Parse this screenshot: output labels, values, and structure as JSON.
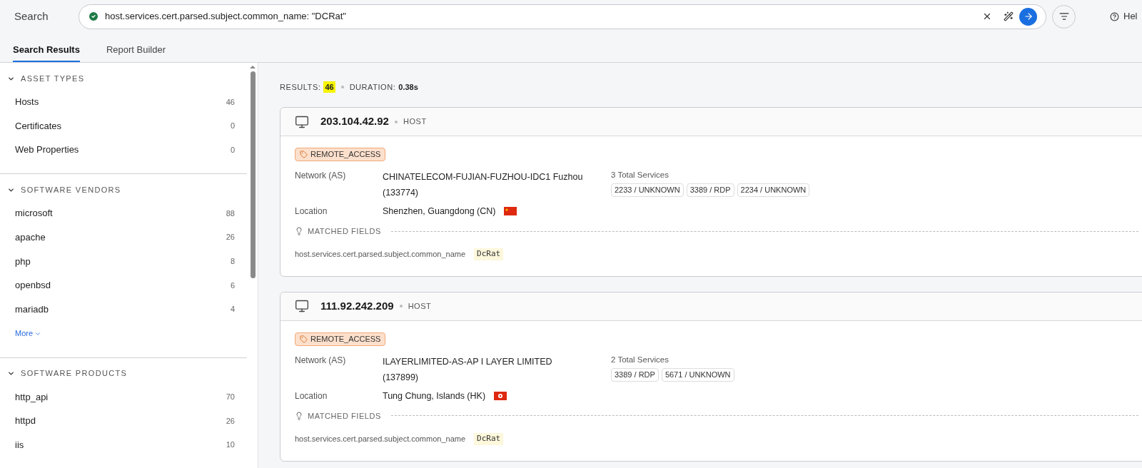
{
  "header": {
    "title": "Search",
    "query": "host.services.cert.parsed.subject.common_name: \"DCRat\"",
    "help": "Hel"
  },
  "tabs": [
    {
      "label": "Search Results",
      "selected": true
    },
    {
      "label": "Report Builder",
      "selected": false
    }
  ],
  "sidebar": {
    "sections": [
      {
        "title": "ASSET TYPES",
        "expanded": true,
        "items": [
          {
            "label": "Hosts",
            "count": "46"
          },
          {
            "label": "Certificates",
            "count": "0"
          },
          {
            "label": "Web Properties",
            "count": "0"
          }
        ]
      },
      {
        "title": "SOFTWARE VENDORS",
        "expanded": true,
        "items": [
          {
            "label": "microsoft",
            "count": "88"
          },
          {
            "label": "apache",
            "count": "26"
          },
          {
            "label": "php",
            "count": "8"
          },
          {
            "label": "openbsd",
            "count": "6"
          },
          {
            "label": "mariadb",
            "count": "4"
          }
        ],
        "more": "More"
      },
      {
        "title": "SOFTWARE PRODUCTS",
        "expanded": true,
        "items": [
          {
            "label": "http_api",
            "count": "70"
          },
          {
            "label": "httpd",
            "count": "26"
          },
          {
            "label": "iis",
            "count": "10"
          }
        ]
      }
    ]
  },
  "summary": {
    "results_label": "RESULTS:",
    "results": "46",
    "results_highlighted": true,
    "duration_label": "DURATION:",
    "duration": "0.38s"
  },
  "results": [
    {
      "ip": "203.104.42.92",
      "type": "HOST",
      "tag": "REMOTE_ACCESS",
      "network_label": "Network (AS)",
      "network": "CHINATELECOM-FUJIAN-FUZHOU-IDC1 Fuzhou",
      "asn": "(133774)",
      "location_label": "Location",
      "location": "Shenzhen, Guangdong (CN)",
      "flag": {
        "kind": "cn"
      },
      "services_total": "3 Total Services",
      "services": [
        "2233 / UNKNOWN",
        "3389 / RDP",
        "2234 / UNKNOWN"
      ],
      "matched_label": "MATCHED FIELDS",
      "field": "host.services.cert.parsed.subject.common_name",
      "value": "DcRat"
    },
    {
      "ip": "111.92.242.209",
      "type": "HOST",
      "tag": "REMOTE_ACCESS",
      "network_label": "Network (AS)",
      "network": "ILAYERLIMITED-AS-AP I LAYER LIMITED",
      "asn": "(137899)",
      "location_label": "Location",
      "location": "Tung Chung, Islands (HK)",
      "flag": {
        "kind": "hk"
      },
      "services_total": "2 Total Services",
      "services": [
        "3389 / RDP",
        "5671 / UNKNOWN"
      ],
      "matched_label": "MATCHED FIELDS",
      "field": "host.services.cert.parsed.subject.common_name",
      "value": "DcRat"
    }
  ]
}
